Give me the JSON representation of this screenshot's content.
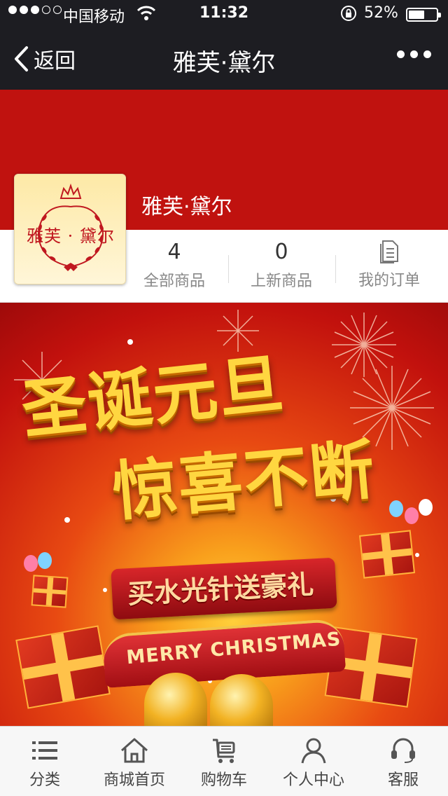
{
  "status_bar": {
    "carrier": "中国移动",
    "time": "11:32",
    "battery": "52%",
    "battery_level": 0.52,
    "signal_bars_filled": 3,
    "signal_bars_total": 5
  },
  "nav": {
    "back_label": "返回",
    "title": "雅芙·黛尔"
  },
  "store": {
    "name": "雅芙·黛尔",
    "logo_text": "雅芙 · 黛尔",
    "banner_color": "#c0120f",
    "stats": [
      {
        "value": "4",
        "label": "全部商品"
      },
      {
        "value": "0",
        "label": "上新商品"
      },
      {
        "label": "我的订单",
        "icon": "document-icon"
      }
    ]
  },
  "promo": {
    "line1": "圣诞元旦",
    "line2": "惊喜不断",
    "ribbon_top": "买水光针送豪礼",
    "ribbon_bottom": "MERRY CHRISTMAS"
  },
  "tab_bar": {
    "items": [
      {
        "label": "分类",
        "icon": "list-icon"
      },
      {
        "label": "商城首页",
        "icon": "home-icon"
      },
      {
        "label": "购物车",
        "icon": "cart-icon"
      },
      {
        "label": "个人中心",
        "icon": "person-icon"
      },
      {
        "label": "客服",
        "icon": "headset-icon"
      }
    ]
  }
}
